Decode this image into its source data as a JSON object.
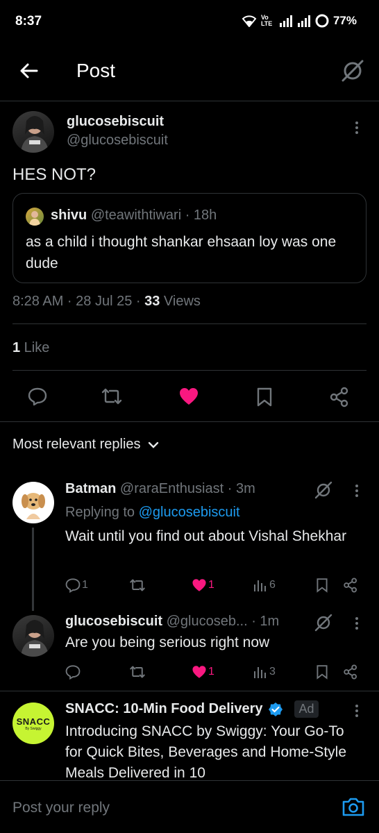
{
  "status": {
    "time": "8:37",
    "volte": "Vo\nLTE",
    "battery": "77%"
  },
  "header": {
    "title": "Post"
  },
  "post": {
    "display_name": "glucosebiscuit",
    "handle": "@glucosebiscuit",
    "text": "HES NOT?",
    "quote": {
      "display_name": "shivu",
      "handle": "@teawithtiwari",
      "time": "· 18h",
      "text": "as a child i thought shankar ehsaan loy was one dude"
    },
    "meta_time": "8:28 AM · 28 Jul 25 · ",
    "views_count": "33",
    "views_label": " Views",
    "likes_count": "1",
    "likes_label": " Like"
  },
  "replies_header": "Most relevant replies",
  "replies": [
    {
      "display_name": "Batman",
      "handle": "@raraEnthusiast",
      "time": "· 3m",
      "replying_prefix": "Replying to ",
      "replying_to": "@glucosebiscuit",
      "text": "Wait until you find out about Vishal Shekhar",
      "replies": "1",
      "likes": "1",
      "views": "6"
    },
    {
      "display_name": "glucosebiscuit",
      "handle": "@glucoseb...",
      "time": "· 1m",
      "text": "Are you being serious right now",
      "likes": "1",
      "views": "3"
    }
  ],
  "ad": {
    "display_name": "SNACC: 10-Min Food Delivery",
    "badge": "Ad",
    "logo_text": "SNACC",
    "logo_sub": "By Swiggy",
    "text": "Introducing SNACC by Swiggy: Your Go-To for Quick Bites, Beverages and Home-Style Meals Delivered in 10"
  },
  "reply_input": {
    "placeholder": "Post your reply"
  },
  "colors": {
    "accent": "#1d9bf0",
    "like": "#f91880",
    "snacc": "#c6f432"
  }
}
